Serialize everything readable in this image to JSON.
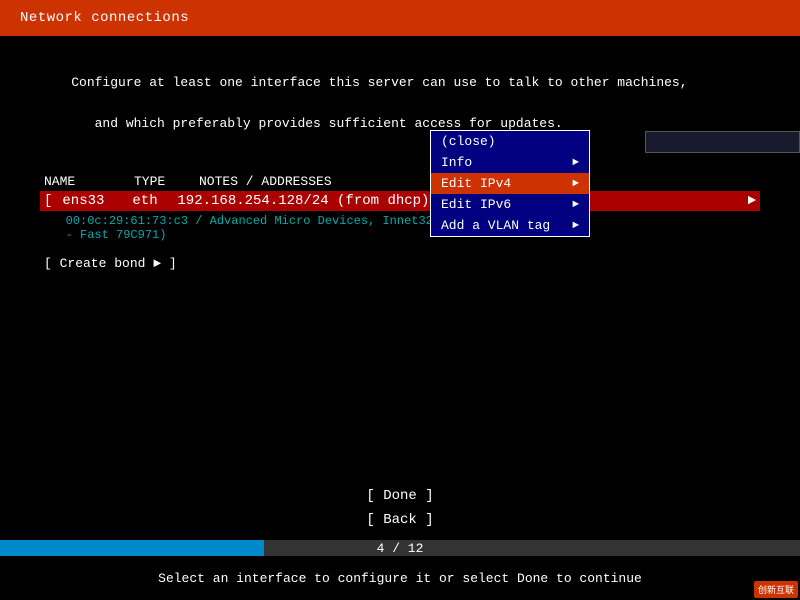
{
  "titleBar": {
    "label": "Network connections"
  },
  "description": {
    "line1": "Configure at least one interface this server can use to talk to other machines,",
    "line2": "   and which preferably provides sufficient access for updates."
  },
  "tableHeader": {
    "name": "NAME",
    "type": "TYPE",
    "notes": "NOTES / ADDRESSES"
  },
  "interface": {
    "name": "ens33",
    "type": "eth",
    "address": "192.168.254.128/24 (from dhcp)",
    "macAndVendor": "00:0c:29:61:73:c3 / Advanced Micro Devices, In",
    "model": "net32 LANCE] (PCnet",
    "modelSuffix": "- Fast 79C971)"
  },
  "contextMenu": {
    "items": [
      {
        "id": "close",
        "label": "(close)",
        "hasArrow": false,
        "selected": false
      },
      {
        "id": "info",
        "label": "Info",
        "hasArrow": true,
        "selected": false
      },
      {
        "id": "edit-ipv4",
        "label": "Edit IPv4",
        "hasArrow": true,
        "selected": true
      },
      {
        "id": "edit-ipv6",
        "label": "Edit IPv6",
        "hasArrow": true,
        "selected": false
      },
      {
        "id": "add-vlan",
        "label": "Add a VLAN tag",
        "hasArrow": true,
        "selected": false
      }
    ]
  },
  "createBond": {
    "label": "[ Create bond ► ]"
  },
  "buttons": {
    "done": "[ Done      ]",
    "back": "[ Back      ]"
  },
  "progress": {
    "label": "4 / 12"
  },
  "statusBar": {
    "text": "Select an interface to configure it or select Done to continue"
  },
  "watermark": {
    "text": "创新互联"
  }
}
